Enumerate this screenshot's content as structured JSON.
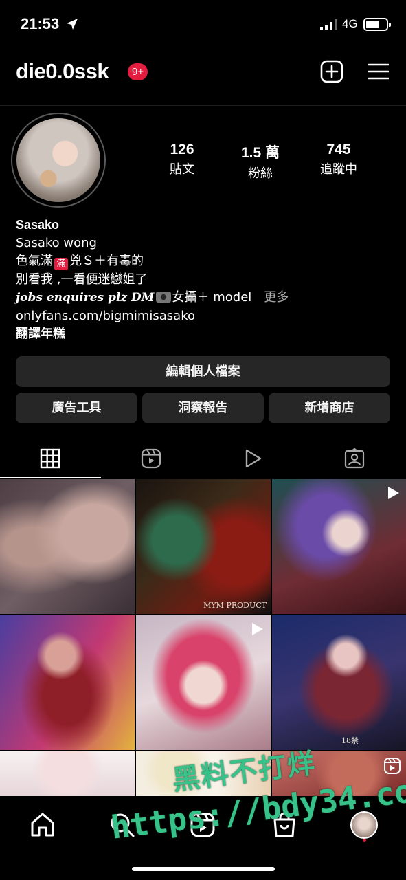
{
  "status_bar": {
    "time": "21:53",
    "network": "4G"
  },
  "header": {
    "username": "die0.0ssk",
    "badge": "9+",
    "icons": [
      "plus-square-icon",
      "menu-icon"
    ]
  },
  "stats": [
    {
      "value": "126",
      "label": "貼文"
    },
    {
      "value": "1.5 萬",
      "label": "粉絲"
    },
    {
      "value": "745",
      "label": "追蹤中"
    }
  ],
  "bio": {
    "name": "Sasako",
    "line1": "Sasako wong",
    "line2_pre": "色氣滿",
    "line2_icon": "滿",
    "line2_post": "兇Ｓ＋有毒的",
    "line3": "別看我 ,一看便迷戀姐了",
    "line4_pre": "jobs enquires  plz DM",
    "line4_post": "女攝＋ model",
    "more": "更多",
    "link": "onlyfans.com/bigmimisasako",
    "translate": "翻譯年糕"
  },
  "buttons": {
    "edit_profile": "編輯個人檔案",
    "ad_tools": "廣告工具",
    "insights": "洞察報告",
    "add_shop": "新增商店"
  },
  "tabs": [
    "grid-icon",
    "reels-icon",
    "video-icon",
    "tagged-icon"
  ],
  "grid": {
    "post2_caption": "MYM PRODUCT",
    "post6_caption": "18禁"
  },
  "bottom_nav": [
    "home-icon",
    "search-icon",
    "reels-icon",
    "shop-icon",
    "profile-avatar"
  ],
  "watermark": {
    "line1": "黑料不打烊",
    "line2": "https://bdy34.co"
  },
  "colors": {
    "background": "#000000",
    "badge": "#e41d40",
    "button": "#262626",
    "watermark": "#37c28a"
  }
}
